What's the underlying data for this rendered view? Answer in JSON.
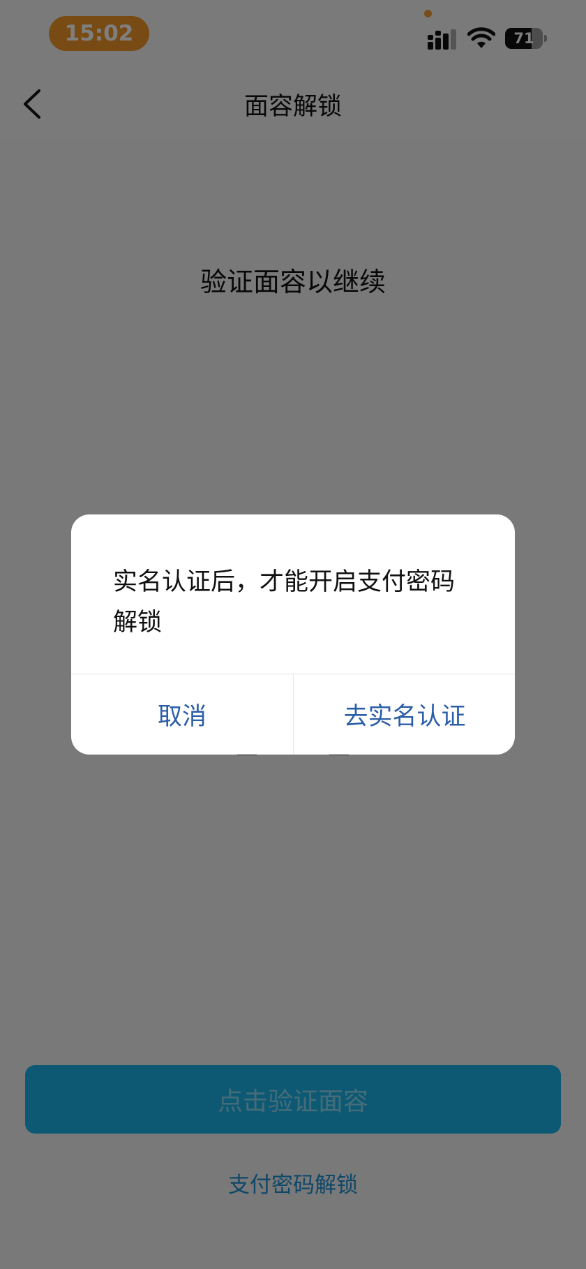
{
  "status_bar": {
    "time": "15:02",
    "battery_level": "71",
    "battery_fraction": 0.71,
    "icons": [
      "signal-icon",
      "wifi-icon",
      "battery-icon"
    ]
  },
  "nav": {
    "title": "面容解锁",
    "back_icon": "chevron-left-icon"
  },
  "main": {
    "prompt": "验证面容以继续",
    "face_icon": "face-id-icon",
    "primary_button": "点击验证面容",
    "secondary_link": "支付密码解锁"
  },
  "dialog": {
    "message": "实名认证后，才能开启支付密码解锁",
    "cancel_label": "取消",
    "confirm_label": "去实名认证"
  },
  "colors": {
    "time_pill": "#f0962b",
    "primary_button": "#1bb3e6",
    "link": "#1d8fd0",
    "dialog_button_text": "#2b5ea8"
  }
}
